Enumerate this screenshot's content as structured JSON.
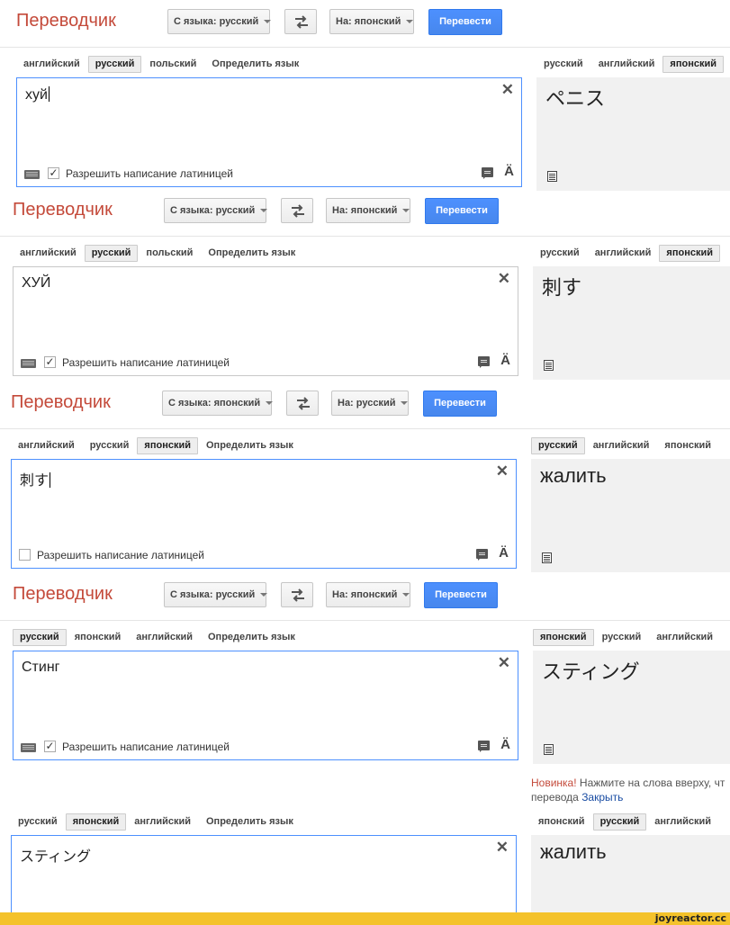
{
  "app_title": "Переводчик",
  "translate_label": "Перевести",
  "latin_label": "Разрешить написание латиницей",
  "panels": [
    {
      "from_label": "С языка: русский",
      "to_label": "На: японский",
      "src_tabs": [
        "английский",
        "русский",
        "польский",
        "Определить язык"
      ],
      "src_selected": 1,
      "res_tabs": [
        "русский",
        "английский",
        "японский"
      ],
      "res_selected": 2,
      "source_text": "хуй",
      "result_text": "ペニス",
      "latin_checked": true
    },
    {
      "from_label": "С языка: русский",
      "to_label": "На: японский",
      "src_tabs": [
        "английский",
        "русский",
        "польский",
        "Определить язык"
      ],
      "src_selected": 1,
      "res_tabs": [
        "русский",
        "английский",
        "японский"
      ],
      "res_selected": 2,
      "source_text": "ХУЙ",
      "result_text": "刺す",
      "latin_checked": true
    },
    {
      "from_label": "С языка: японский",
      "to_label": "На: русский",
      "src_tabs": [
        "английский",
        "русский",
        "японский",
        "Определить язык"
      ],
      "src_selected": 2,
      "res_tabs": [
        "русский",
        "английский",
        "японский"
      ],
      "res_selected": 0,
      "source_text": "刺す",
      "result_text": "жалить",
      "latin_checked": false
    },
    {
      "from_label": "С языка: русский",
      "to_label": "На: японский",
      "src_tabs": [
        "русский",
        "японский",
        "английский",
        "Определить язык"
      ],
      "src_selected": 0,
      "res_tabs": [
        "японский",
        "русский",
        "английский"
      ],
      "res_selected": 0,
      "source_text": "Стинг",
      "result_text": "スティング",
      "latin_checked": true
    },
    {
      "src_tabs": [
        "русский",
        "японский",
        "английский",
        "Определить язык"
      ],
      "src_selected": 1,
      "res_tabs": [
        "японский",
        "русский",
        "английский"
      ],
      "res_selected": 1,
      "source_text": "スティング",
      "result_text": "жалить"
    }
  ],
  "notice": {
    "new_label": "Новинка!",
    "line1": " Нажмите на слова вверху, чт",
    "line2": "перевода ",
    "close_label": "Закрыть"
  },
  "watermark": "joyreactor.cc",
  "colors": {
    "title": "#c44a3a",
    "button_blue": "#4d90fe",
    "footer_yellow": "#f4c22b"
  }
}
